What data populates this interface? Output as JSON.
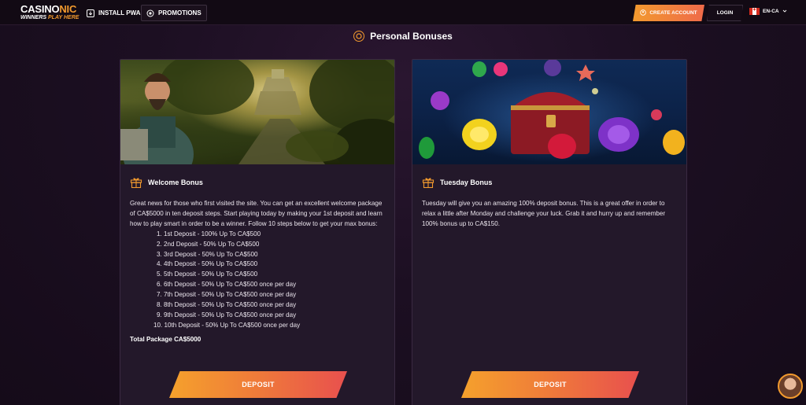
{
  "header": {
    "logo_main_a": "CASINO",
    "logo_main_b": "NIC",
    "logo_sub_a": "WINNERS ",
    "logo_sub_b": "PLAY HERE",
    "install_pwa": "INSTALL PWA",
    "promotions": "PROMOTIONS",
    "create_account": "CREATE ACCOUNT",
    "login": "LOGIN",
    "language": "EN-CA"
  },
  "page": {
    "title": "Personal Bonuses"
  },
  "cards": [
    {
      "title": "Welcome Bonus",
      "description": "Great news for those who first visited the site. You can get an excellent welcome package of CA$5000 in ten deposit steps. Start playing today by making your 1st deposit and learn how to play smart in order to be a winner. Follow 10 steps below to get your max bonus:",
      "steps": [
        "1. 1st Deposit - 100% Up To CA$500",
        "2. 2nd Deposit - 50% Up To CA$500",
        "3. 3rd Deposit - 50% Up To CA$500",
        "4. 4th Deposit - 50% Up To CA$500",
        "5. 5th Deposit - 50% Up To CA$500",
        "6. 6th Deposit - 50% Up To CA$500 once per day",
        "7. 7th Deposit - 50% Up To CA$500 once per day",
        "8. 8th Deposit - 50% Up To CA$500 once per day",
        "9. 9th Deposit - 50% Up To CA$500 once per day",
        "10. 10th Deposit - 50% Up To CA$500 once per day"
      ],
      "total": "Total Package CA$5000",
      "button": "DEPOSIT"
    },
    {
      "title": "Tuesday Bonus",
      "description": "Tuesday will give you an amazing 100% deposit bonus. This is a great offer in order to relax a little after Monday and challenge your luck. Grab it and hurry up and remember 100% bonus up to CA$150.",
      "button": "DEPOSIT"
    }
  ],
  "colors": {
    "accent": "#f29a2e",
    "button_end": "#e8504e",
    "card_bg": "#23182a"
  }
}
